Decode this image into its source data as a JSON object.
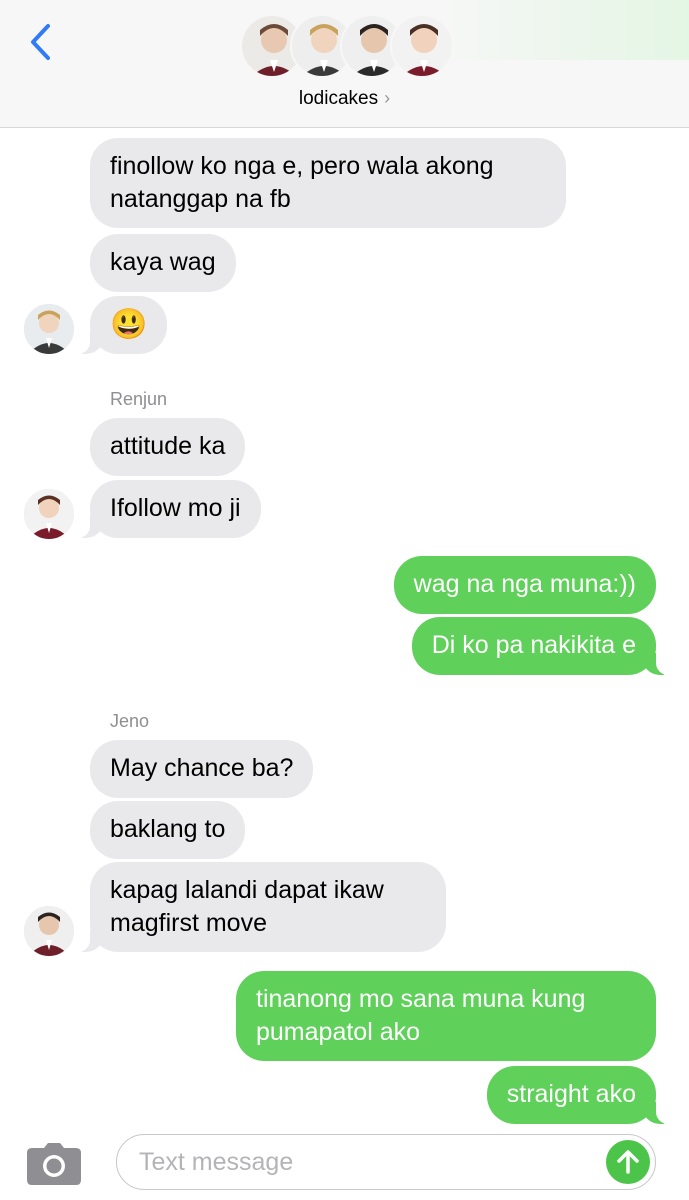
{
  "header": {
    "title": "lodicakes",
    "chevron": "›",
    "back_icon": "chevron-left-icon",
    "accent": "#2f7cf6"
  },
  "messages": {
    "m1": {
      "line1": "finollow ko nga e, pero wala akong",
      "line2": "natanggap na fb"
    },
    "m2": "kaya wag",
    "m3": "😃",
    "renjun_label": "Renjun",
    "m4": "attitude ka",
    "m5": "Ifollow mo ji",
    "m6": "wag na nga muna:))",
    "m7": "Di ko pa nakikita e",
    "jeno_label": "Jeno",
    "m8": "May chance ba?",
    "m9": "baklang to",
    "m10": {
      "line1": "kapag lalandi dapat ikaw",
      "line2": "magfirst move"
    },
    "m11": {
      "line1": "tinanong mo sana muna kung",
      "line2": "pumapatol ako"
    },
    "m12": "straight ako"
  },
  "composer": {
    "placeholder": "Text message",
    "camera_icon": "camera-icon",
    "send_icon": "arrow-up-icon"
  },
  "colors": {
    "incoming": "#e9e9eb",
    "outgoing": "#5fd05a",
    "send": "#4cc44a"
  }
}
